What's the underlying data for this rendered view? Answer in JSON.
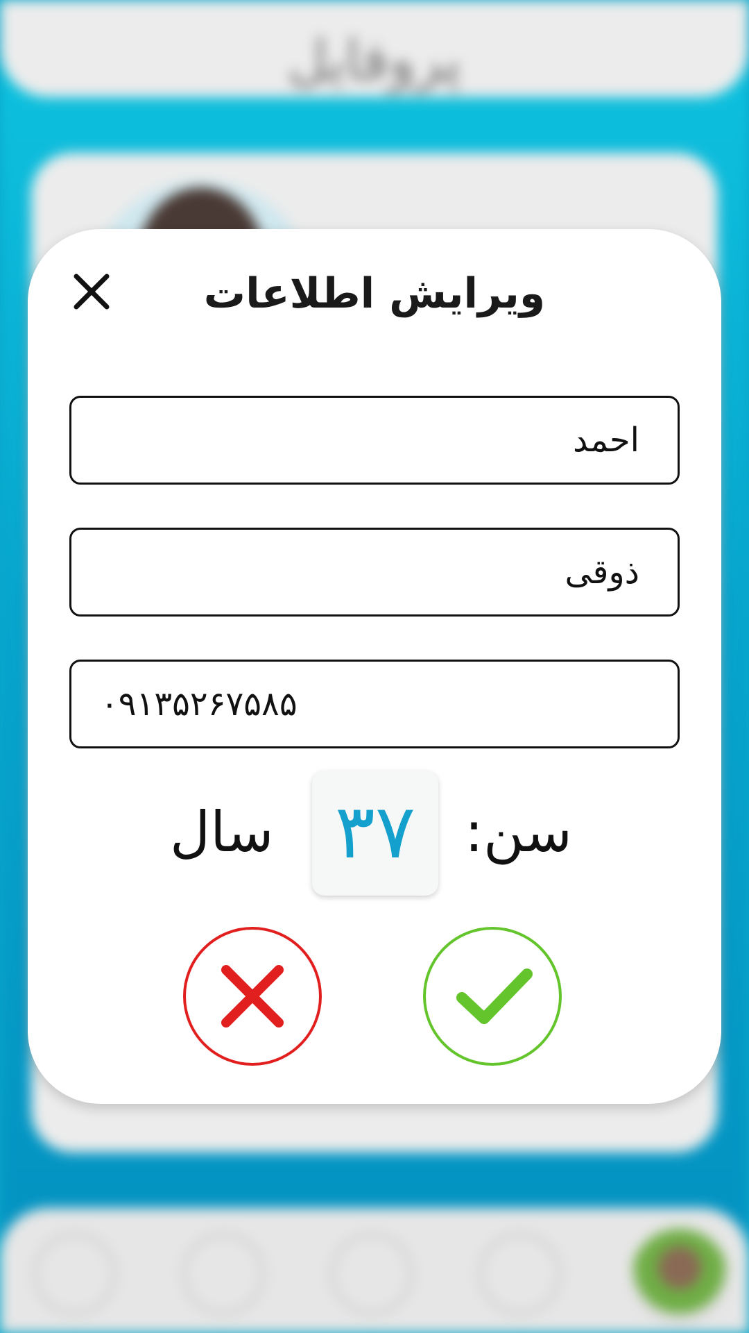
{
  "background": {
    "header_title": "پروفایل"
  },
  "modal": {
    "title": "ویرایش اطلاعات",
    "fields": {
      "first_name": "احمد",
      "last_name": "ذوقی",
      "phone": "۰۹۱۳۵۲۶۷۵۸۵"
    },
    "age": {
      "label": "سن:",
      "value": "۳۷",
      "unit": "سال"
    },
    "buttons": {
      "cancel_icon": "close-icon",
      "confirm_icon": "check-icon"
    }
  },
  "colors": {
    "accent": "#14a0cc",
    "cancel": "#e21f1f",
    "confirm": "#63c52b",
    "background": "#0aa6c9"
  }
}
